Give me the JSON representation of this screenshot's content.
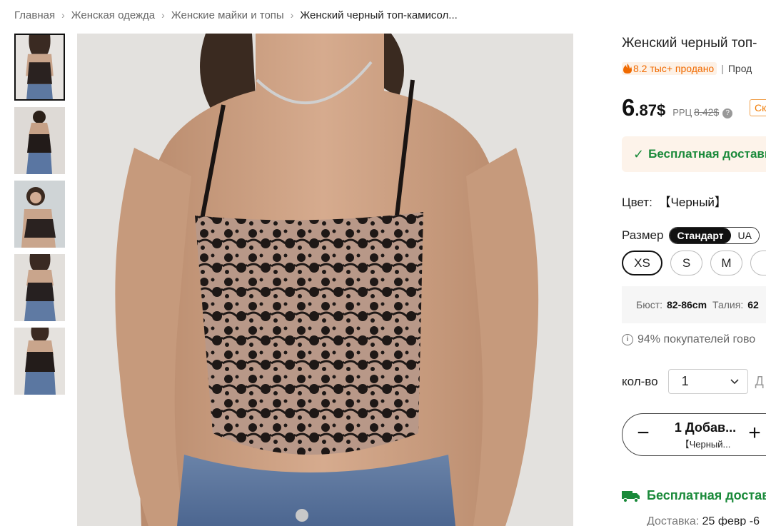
{
  "breadcrumb": {
    "items": [
      "Главная",
      "Женская одежда",
      "Женские майки и топы"
    ],
    "current": "Женский черный топ-камисол..."
  },
  "product": {
    "title": "Женский черный топ-",
    "sold": "8.2 тыс+ продано",
    "sold_more": "Прод",
    "price_int": "6",
    "price_dec": ".87$",
    "rrp_label": "РРЦ",
    "rrp_old": "8.42$",
    "help": "?",
    "discount": "Ск",
    "free_shipping": "Бесплатная доставк",
    "color_label": "Цвет:",
    "color_value": "【Черный】",
    "size_label": "Размер",
    "size_switch": [
      "Стандарт",
      "UA"
    ],
    "sizes": [
      "XS",
      "S",
      "M"
    ],
    "measurements": {
      "bust_label": "Бюст:",
      "bust_value": "82-86cm",
      "waist_label": "Талия:",
      "waist_value": "62"
    },
    "fit_text": "94% покупателей гово",
    "qty_label": "кол-во",
    "qty_value": "1",
    "qty_extra": "Д",
    "cart_line1": "1 Добав...",
    "cart_line2": "【Черный...",
    "cart_minus": "−",
    "cart_plus": "+",
    "delivery_title": "Бесплатная достав",
    "delivery_label": "Доставка:",
    "delivery_value": "25 февр -6"
  },
  "icons": {
    "fire": "fire-icon",
    "check": "check-icon",
    "info": "info-icon",
    "truck": "truck-icon",
    "chevron": "chevron-down-icon"
  },
  "colors": {
    "accent_orange": "#f06a00",
    "success_green": "#1a8a3a",
    "banner_bg": "#fdf3ea"
  }
}
